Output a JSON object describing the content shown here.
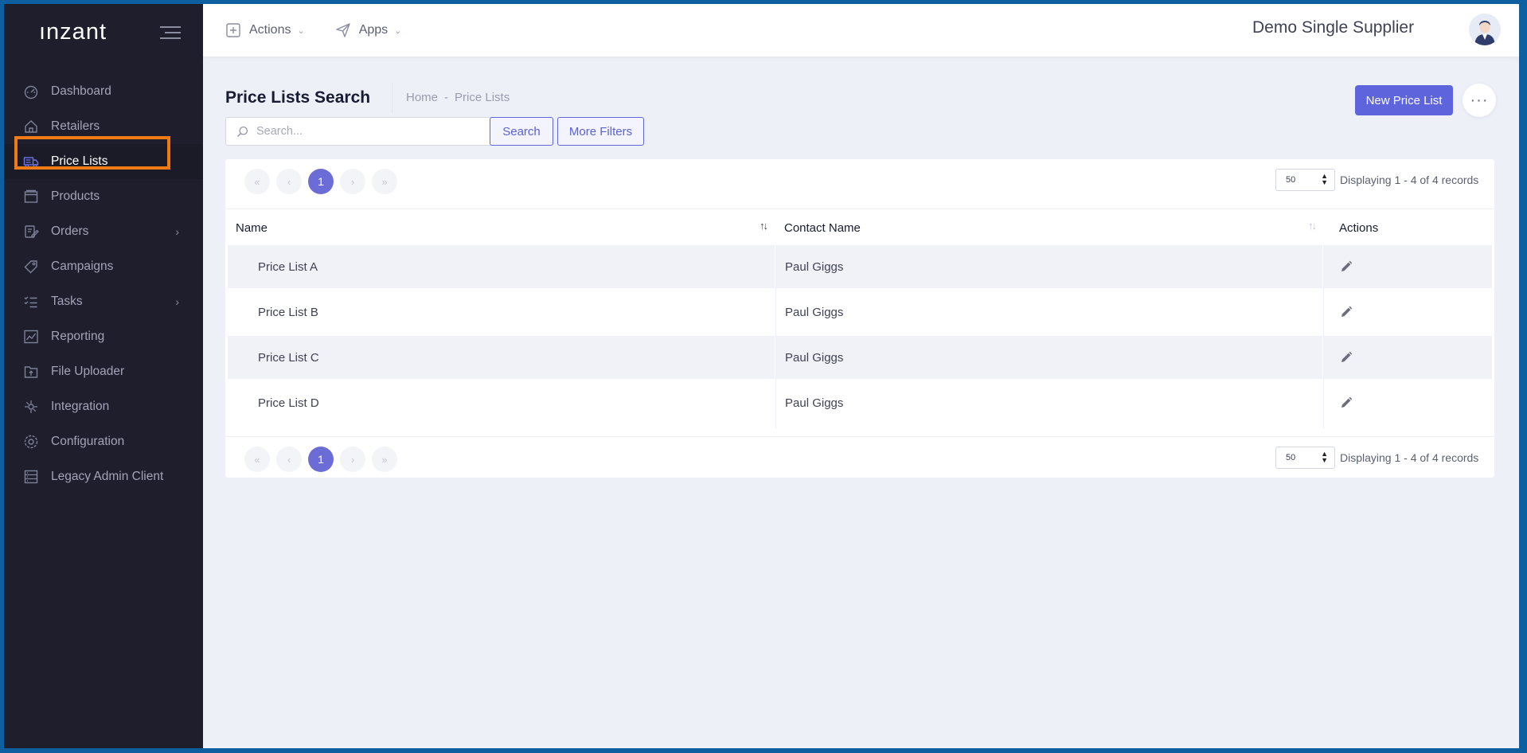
{
  "brand": {
    "logo": "ınzant"
  },
  "sidebar": {
    "items": [
      {
        "label": "Dashboard",
        "icon": "dashboard-gauge-icon",
        "has_submenu": false
      },
      {
        "label": "Retailers",
        "icon": "home-icon",
        "has_submenu": false
      },
      {
        "label": "Price Lists",
        "icon": "truck-icon",
        "has_submenu": false,
        "active": true
      },
      {
        "label": "Products",
        "icon": "box-icon",
        "has_submenu": false
      },
      {
        "label": "Orders",
        "icon": "clipboard-edit-icon",
        "has_submenu": true
      },
      {
        "label": "Campaigns",
        "icon": "tag-icon",
        "has_submenu": false
      },
      {
        "label": "Tasks",
        "icon": "checklist-icon",
        "has_submenu": true
      },
      {
        "label": "Reporting",
        "icon": "chart-icon",
        "has_submenu": false
      },
      {
        "label": "File Uploader",
        "icon": "upload-file-icon",
        "has_submenu": false
      },
      {
        "label": "Integration",
        "icon": "integration-icon",
        "has_submenu": false
      },
      {
        "label": "Configuration",
        "icon": "gear-icon",
        "has_submenu": false
      },
      {
        "label": "Legacy Admin Client",
        "icon": "server-icon",
        "has_submenu": false
      }
    ],
    "submenu_chevron": "›"
  },
  "topbar": {
    "actions_label": "Actions",
    "apps_label": "Apps",
    "supplier_name": "Demo Single Supplier"
  },
  "page": {
    "title": "Price Lists Search",
    "breadcrumb": {
      "home": "Home",
      "separator": "-",
      "current": "Price Lists"
    },
    "search_placeholder": "Search...",
    "search_button": "Search",
    "more_filters_button": "More Filters",
    "new_button": "New Price List",
    "more_button": "···"
  },
  "pagination": {
    "first": "«",
    "prev": "‹",
    "current": "1",
    "next": "›",
    "last": "»",
    "page_size": "50",
    "records_text": "Displaying 1 - 4 of 4 records"
  },
  "table": {
    "columns": [
      "Name",
      "Contact Name",
      "Actions"
    ],
    "rows": [
      {
        "name": "Price List A",
        "contact": "Paul Giggs"
      },
      {
        "name": "Price List B",
        "contact": "Paul Giggs"
      },
      {
        "name": "Price List C",
        "contact": "Paul Giggs"
      },
      {
        "name": "Price List D",
        "contact": "Paul Giggs"
      }
    ]
  },
  "colors": {
    "sidebar_bg": "#1e1e2d",
    "accent": "#5d64dc",
    "highlight": "#f07a13",
    "frame": "#0d5f9f"
  }
}
